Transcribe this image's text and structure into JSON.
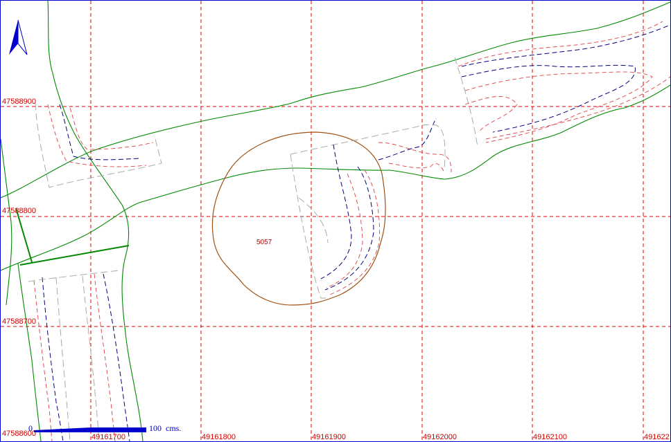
{
  "map": {
    "north_symbol": "north-arrow",
    "colors": {
      "grid": "#e00000",
      "boundary": "#008800",
      "parcel": "#a05010",
      "contour_major": "#000080",
      "contour_minor": "#e04040",
      "road_edge": "#aaaaaa",
      "scale_bar": "#0000cc"
    },
    "y_labels": [
      "47588900",
      "47588800",
      "47588700",
      "47588600"
    ],
    "x_labels": [
      "49161700",
      "49161800",
      "49161900",
      "49162000",
      "49162100",
      "491622"
    ],
    "parcel_label": "5057",
    "scale": {
      "start": "0",
      "end": "100",
      "unit": "cms."
    }
  }
}
